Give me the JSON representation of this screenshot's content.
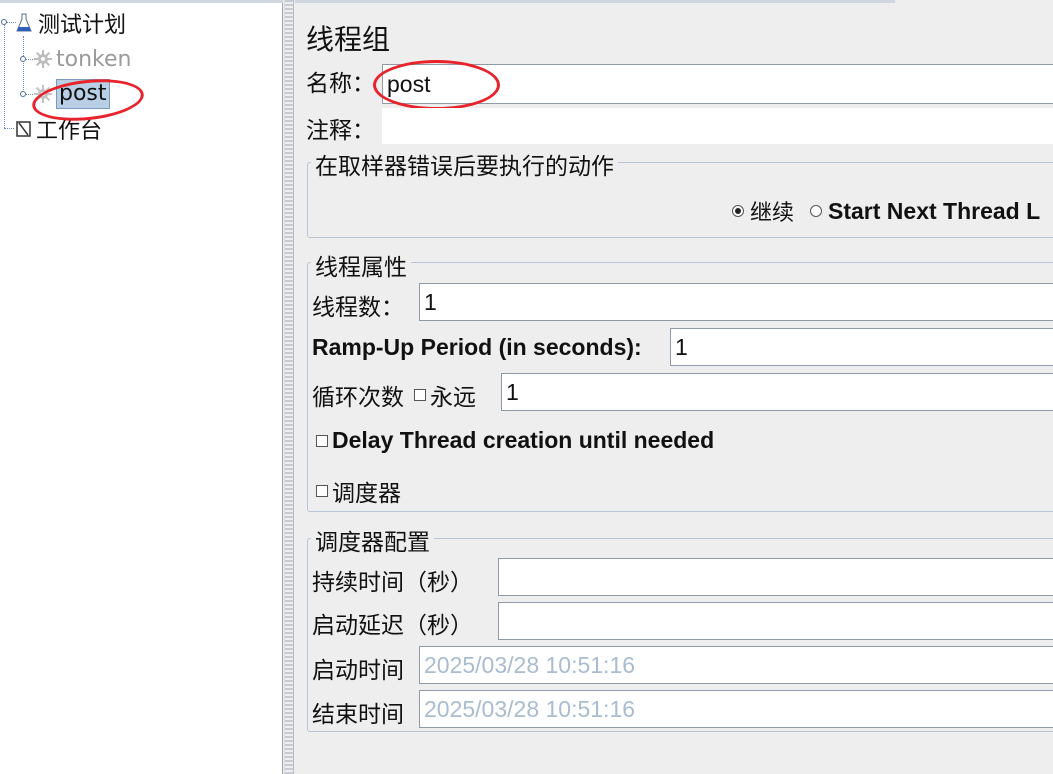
{
  "tree": {
    "root": {
      "label": "测试计划",
      "icon": "flask-icon"
    },
    "children": [
      {
        "label": "tonken",
        "icon": "gear-icon",
        "state": "disabled"
      },
      {
        "label": "post",
        "icon": "gear-icon",
        "state": "selected"
      }
    ],
    "workbench": {
      "label": "工作台",
      "icon": "workbench-icon"
    }
  },
  "panel": {
    "title": "线程组",
    "name_label": "名称：",
    "name_value": "post",
    "comment_label": "注释：",
    "comment_value": ""
  },
  "sampler_error": {
    "title": "在取样器错误后要执行的动作",
    "options": [
      {
        "label": "继续",
        "selected": true
      },
      {
        "label": "Start Next Thread L",
        "selected": false
      }
    ]
  },
  "thread_props": {
    "title": "线程属性",
    "threads_label": "线程数：",
    "threads_value": "1",
    "rampup_label": "Ramp-Up Period (in seconds):",
    "rampup_value": "1",
    "loop_label": "循环次数",
    "forever_label": "永远",
    "loop_value": "1",
    "delay_label": "Delay Thread creation until needed",
    "scheduler_label": "调度器"
  },
  "scheduler_config": {
    "title": "调度器配置",
    "duration_label": "持续时间（秒）",
    "duration_value": "",
    "startup_delay_label": "启动延迟（秒）",
    "startup_delay_value": "",
    "start_time_label": "启动时间",
    "start_time_value": "2025/03/28 10:51:16",
    "end_time_label": "结束时间",
    "end_time_value": "2025/03/28 10:51:16"
  },
  "annotation_color": "#e8232b"
}
